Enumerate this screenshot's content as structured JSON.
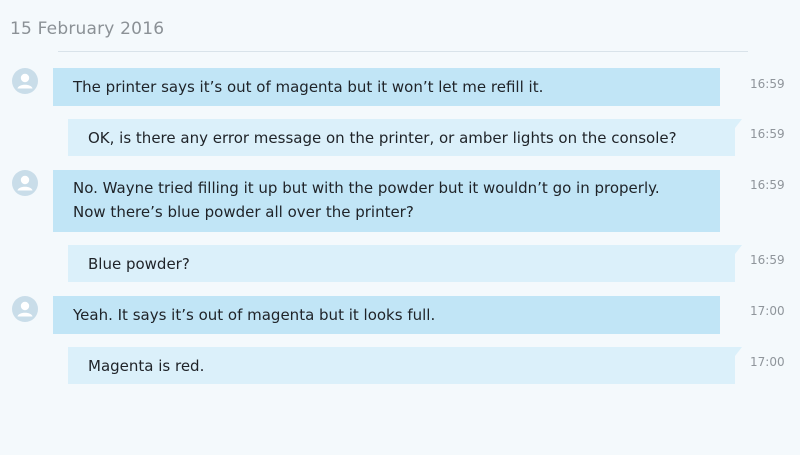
{
  "date_header": "15 February 2016",
  "messages": [
    {
      "direction": "incoming",
      "lines": [
        "The printer says it’s out of magenta but it won’t let me refill it."
      ],
      "time": "16:59"
    },
    {
      "direction": "outgoing",
      "lines": [
        "OK, is there any error message on the printer, or amber lights on the console?"
      ],
      "time": "16:59"
    },
    {
      "direction": "incoming",
      "lines": [
        "No. Wayne tried filling it up but with the powder but it wouldn’t go in properly.",
        "Now there’s blue powder all over the printer?"
      ],
      "time": "16:59"
    },
    {
      "direction": "outgoing",
      "lines": [
        "Blue powder?"
      ],
      "time": "16:59"
    },
    {
      "direction": "incoming",
      "lines": [
        "Yeah. It says it’s out of magenta but it looks full."
      ],
      "time": "17:00"
    },
    {
      "direction": "outgoing",
      "lines": [
        "Magenta is red."
      ],
      "time": "17:00"
    }
  ],
  "colors": {
    "background": "#f4f9fc",
    "incoming_bubble": "#c1e5f6",
    "outgoing_bubble": "#dbf0fa",
    "avatar": "#c9dde9",
    "timestamp": "#8f959b",
    "date_header": "#8b9196"
  },
  "icons": {
    "avatar": "person-icon"
  }
}
